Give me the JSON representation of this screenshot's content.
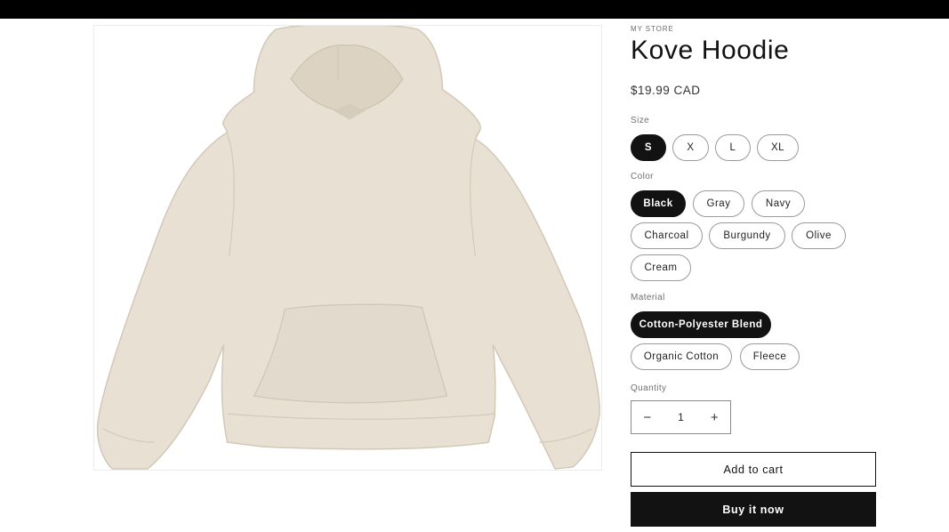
{
  "product": {
    "vendor": "MY STORE",
    "title": "Kove Hoodie",
    "price": "$19.99 CAD",
    "image_alt": "Cream hoodie"
  },
  "options": {
    "size": {
      "label": "Size",
      "values": [
        "S",
        "X",
        "L",
        "XL"
      ],
      "selected": "S"
    },
    "color": {
      "label": "Color",
      "values": [
        "Black",
        "Gray",
        "Navy",
        "Charcoal",
        "Burgundy",
        "Olive",
        "Cream"
      ],
      "selected": "Black"
    },
    "material": {
      "label": "Material",
      "values": [
        "Cotton-Polyester Blend",
        "Organic Cotton",
        "Fleece"
      ],
      "selected": "Cotton-Polyester Blend"
    }
  },
  "quantity": {
    "label": "Quantity",
    "value": "1",
    "decrease_icon": "minus-icon",
    "increase_icon": "plus-icon",
    "decrease": "−",
    "increase": "+"
  },
  "actions": {
    "add_to_cart": "Add to cart",
    "buy_now": "Buy it now"
  },
  "colors": {
    "ink": "#121212",
    "hoodie": "#e8e0d3",
    "border": "#9a9a9a"
  }
}
